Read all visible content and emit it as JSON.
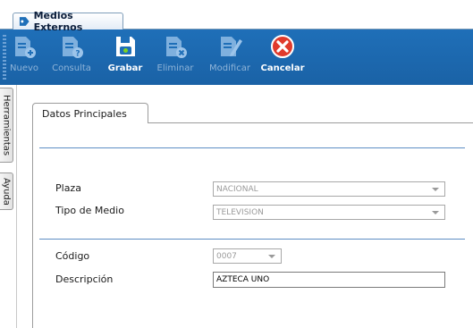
{
  "window_tab": {
    "title": "Medios Externos"
  },
  "toolbar": {
    "buttons": [
      {
        "label": "Nuevo",
        "icon": "doc-plus-icon",
        "enabled": false
      },
      {
        "label": "Consulta",
        "icon": "doc-question-icon",
        "enabled": false
      },
      {
        "label": "Grabar",
        "icon": "save-icon",
        "enabled": true
      },
      {
        "label": "Eliminar",
        "icon": "doc-delete-icon",
        "enabled": false
      },
      {
        "label": "Modificar",
        "icon": "doc-edit-icon",
        "enabled": false
      },
      {
        "label": "Cancelar",
        "icon": "cancel-icon",
        "enabled": true
      }
    ]
  },
  "side_tabs": [
    "Herramientas",
    "Ayuda"
  ],
  "form": {
    "tab_label": "Datos Principales",
    "plaza": {
      "label": "Plaza",
      "value": "NACIONAL"
    },
    "tipo_medio": {
      "label": "Tipo de Medio",
      "value": "TELEVISION"
    },
    "codigo": {
      "label": "Código",
      "value": "0007"
    },
    "descripcion": {
      "label": "Descripción",
      "value": "AZTECA UNO"
    }
  },
  "colors": {
    "toolbar_bg": "#1f6fb8",
    "separator": "#5d8ec4",
    "cancel_red": "#e03a2c",
    "disabled_label": "#8fb4d8"
  }
}
